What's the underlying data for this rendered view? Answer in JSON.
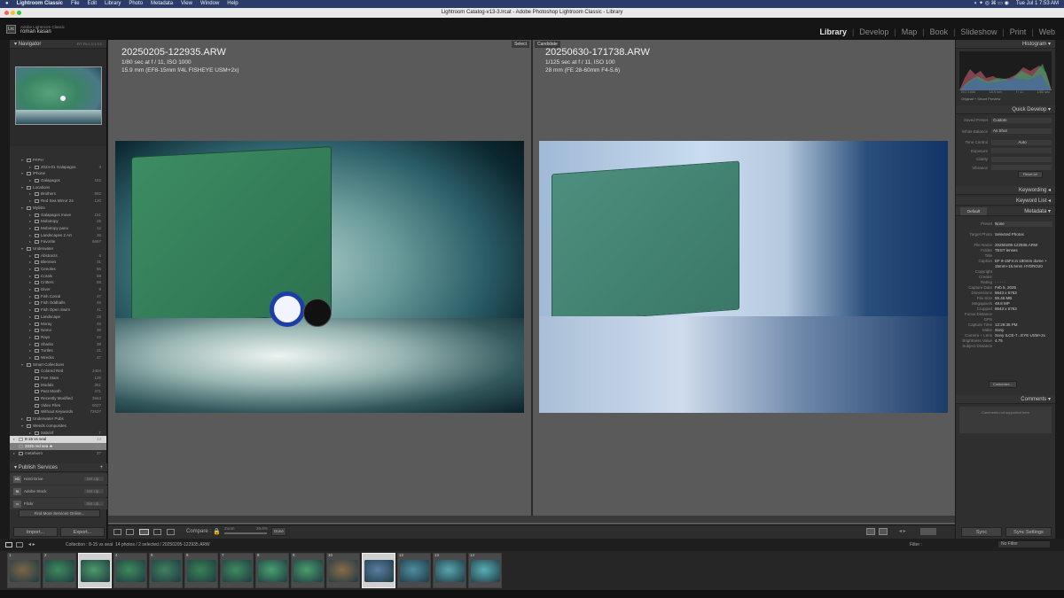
{
  "mac_menu": {
    "apple": "",
    "app": "Lightroom Classic",
    "items": [
      "File",
      "Edit",
      "Library",
      "Photo",
      "Metadata",
      "View",
      "Window",
      "Help"
    ],
    "clock": "Tue Jul 1 7:53 AM"
  },
  "window_title": "Lightroom Catalog-v13-3.lrcat - Adobe Photoshop Lightroom Classic - Library",
  "identity": {
    "sub": "Adobe Lightroom Classic",
    "name": "roman kasan",
    "logo": "Lrc"
  },
  "modules": [
    "Library",
    "Develop",
    "Map",
    "Book",
    "Slideshow",
    "Print",
    "Web"
  ],
  "navigator": {
    "title": "Navigator",
    "opts": "FIT   FILL   1:1   3:1"
  },
  "folders": [
    {
      "label": "FFPH",
      "count": "",
      "lvl": 1,
      "tri": "▾",
      "type": "set"
    },
    {
      "label": "2024-01 Galapagos",
      "count": "3",
      "lvl": 2,
      "tri": "▸",
      "type": "col"
    },
    {
      "label": "iPhone",
      "count": "",
      "lvl": 1,
      "tri": "▾",
      "type": "set"
    },
    {
      "label": "Galapagos",
      "count": "182",
      "lvl": 2,
      "tri": "▸",
      "type": "col"
    },
    {
      "label": "Locations",
      "count": "",
      "lvl": 1,
      "tri": "▾",
      "type": "set"
    },
    {
      "label": "Brothers",
      "count": "992",
      "lvl": 2,
      "tri": "▸",
      "type": "col"
    },
    {
      "label": "Red Sea Mirror 24",
      "count": "130",
      "lvl": 2,
      "tri": "▸",
      "type": "col"
    },
    {
      "label": "Mylists",
      "count": "",
      "lvl": 1,
      "tri": "▾",
      "type": "set"
    },
    {
      "label": "Galapagos move",
      "count": "151",
      "lvl": 2,
      "tri": "▸",
      "type": "col"
    },
    {
      "label": "Mobotopy",
      "count": "25",
      "lvl": 2,
      "tri": "▸",
      "type": "col"
    },
    {
      "label": "Mobotopy pano",
      "count": "12",
      "lvl": 2,
      "tri": "▸",
      "type": "col"
    },
    {
      "label": "Landscapes 2 Art",
      "count": "36",
      "lvl": 2,
      "tri": "▸",
      "type": "col"
    },
    {
      "label": "Favorite",
      "count": "6657",
      "lvl": 2,
      "tri": "▸",
      "type": "col"
    },
    {
      "label": "Underwater",
      "count": "",
      "lvl": 1,
      "tri": "▾",
      "type": "set"
    },
    {
      "label": "Abstracts",
      "count": "6",
      "lvl": 2,
      "tri": "▸",
      "type": "col"
    },
    {
      "label": "Blennies",
      "count": "31",
      "lvl": 2,
      "tri": "▸",
      "type": "col"
    },
    {
      "label": "Cenotes",
      "count": "66",
      "lvl": 2,
      "tri": "▸",
      "type": "col"
    },
    {
      "label": "Corals",
      "count": "59",
      "lvl": 2,
      "tri": "▸",
      "type": "col"
    },
    {
      "label": "Critters",
      "count": "88",
      "lvl": 2,
      "tri": "▸",
      "type": "col"
    },
    {
      "label": "Diver",
      "count": "9",
      "lvl": 2,
      "tri": "▸",
      "type": "col"
    },
    {
      "label": "Fish Corral",
      "count": "47",
      "lvl": 2,
      "tri": "▸",
      "type": "col"
    },
    {
      "label": "Fish Oddballs",
      "count": "46",
      "lvl": 2,
      "tri": "▸",
      "type": "col"
    },
    {
      "label": "Fish Open Swim",
      "count": "41",
      "lvl": 2,
      "tri": "▸",
      "type": "col"
    },
    {
      "label": "Landscape",
      "count": "29",
      "lvl": 2,
      "tri": "▸",
      "type": "col"
    },
    {
      "label": "Moray",
      "count": "46",
      "lvl": 2,
      "tri": "▸",
      "type": "col"
    },
    {
      "label": "Nemo",
      "count": "36",
      "lvl": 2,
      "tri": "▸",
      "type": "col"
    },
    {
      "label": "Rays",
      "count": "22",
      "lvl": 2,
      "tri": "▸",
      "type": "col"
    },
    {
      "label": "Sharks",
      "count": "38",
      "lvl": 2,
      "tri": "▸",
      "type": "col"
    },
    {
      "label": "Turtles",
      "count": "31",
      "lvl": 2,
      "tri": "▸",
      "type": "col"
    },
    {
      "label": "Wrecks",
      "count": "47",
      "lvl": 2,
      "tri": "▸",
      "type": "col"
    },
    {
      "label": "Smart Collections",
      "count": "",
      "lvl": 1,
      "tri": "▾",
      "type": "set"
    },
    {
      "label": "Colored Red",
      "count": "2404",
      "lvl": 2,
      "tri": "",
      "type": "smart"
    },
    {
      "label": "Five Stars",
      "count": "125",
      "lvl": 2,
      "tri": "",
      "type": "smart"
    },
    {
      "label": "Modals",
      "count": "351",
      "lvl": 2,
      "tri": "",
      "type": "smart"
    },
    {
      "label": "Past Month",
      "count": "471",
      "lvl": 2,
      "tri": "",
      "type": "smart"
    },
    {
      "label": "Recently Modified",
      "count": "3663",
      "lvl": 2,
      "tri": "",
      "type": "smart"
    },
    {
      "label": "Video Files",
      "count": "6027",
      "lvl": 2,
      "tri": "",
      "type": "smart"
    },
    {
      "label": "Without Keywords",
      "count": "72637",
      "lvl": 2,
      "tri": "",
      "type": "smart"
    },
    {
      "label": "Underwater Pubs",
      "count": "",
      "lvl": 1,
      "tri": "▸",
      "type": "set"
    },
    {
      "label": "Weeds composites",
      "count": "",
      "lvl": 1,
      "tri": "▾",
      "type": "set"
    },
    {
      "label": "Sabrinf",
      "count": "7",
      "lvl": 2,
      "tri": "▸",
      "type": "col"
    },
    {
      "label": "8-15 vs seal",
      "count": "14",
      "lvl": 0,
      "tri": "▸",
      "type": "col",
      "sel": 2
    },
    {
      "label": "2025 red sea ★",
      "count": "956",
      "lvl": 0,
      "tri": "▸",
      "type": "col",
      "sel": 1
    },
    {
      "label": "metahiero",
      "count": "37",
      "lvl": 0,
      "tri": "▸",
      "type": "col"
    }
  ],
  "publish": {
    "title": "Publish Services",
    "items": [
      {
        "icon": "HD",
        "label": "Hard Drive",
        "action": "Set Up..."
      },
      {
        "icon": "St",
        "label": "Adobe Stock",
        "action": "Set Up..."
      },
      {
        "icon": "••",
        "label": "Flickr",
        "action": "Set Up..."
      }
    ],
    "find_more": "Find More Services Online..."
  },
  "import_btn": "Import...",
  "export_btn": "Export...",
  "select": {
    "badge": "Select",
    "filename": "20250205-122935.ARW",
    "exposure": "1/80 sec at f / 11, ISO 1000",
    "lens": "15.9 mm (EF8-15mm f/4L FISHEYE USM+2x)"
  },
  "candidate": {
    "badge": "Candidate",
    "filename": "20250630-171738.ARW",
    "exposure": "1/125 sec at f / 11, ISO 100",
    "lens": "28 mm (FE 28-60mm F4-5.6)"
  },
  "toolbar": {
    "compare": "Compare :",
    "zoom": "Zoom",
    "zoom_val": "29.8%",
    "done": "Done"
  },
  "filmstrip": {
    "path": "Collection : 8-15 vs seal",
    "info": "14 photos / 2 selected / 20250205-122935.ARW",
    "filter": "Filter :",
    "filter_val": "No Filter"
  },
  "thumbs": [
    {
      "n": "1",
      "c": "#7d6547"
    },
    {
      "n": "2",
      "c": "#3f8a5c"
    },
    {
      "n": "3",
      "c": "#4e9a6a",
      "sel": true
    },
    {
      "n": "4",
      "c": "#3f8a5c"
    },
    {
      "n": "5",
      "c": "#41805e"
    },
    {
      "n": "6",
      "c": "#3a8254"
    },
    {
      "n": "7",
      "c": "#418a5e"
    },
    {
      "n": "8",
      "c": "#49a070"
    },
    {
      "n": "9",
      "c": "#4a9e6c"
    },
    {
      "n": "10",
      "c": "#8a6a4a"
    },
    {
      "n": "11",
      "c": "#5a7ea3",
      "sel": true
    },
    {
      "n": "12",
      "c": "#4f8ca0"
    },
    {
      "n": "13",
      "c": "#58a5b0"
    },
    {
      "n": "14",
      "c": "#5aaeb5"
    }
  ],
  "histogram": {
    "title": "Histogram",
    "labels": [
      "ISO 1000",
      "15.9 mm",
      "f / 11",
      "1/80 sec"
    ],
    "preview": "Original + Smart Preview"
  },
  "quick_develop": {
    "title": "Quick Develop",
    "saved_preset": "Saved Preset",
    "preset_val": "Custom",
    "white_balance": "White Balance",
    "wb_val": "As Shot",
    "tone_control": "Tone Control",
    "auto": "Auto",
    "exposure": "Exposure",
    "clarity": "Clarity",
    "vibrance": "Vibrance",
    "reset": "Reset All"
  },
  "keywording": "Keywording",
  "keyword_list": "Keyword List",
  "metadata": {
    "title": "Metadata",
    "preset": "Default",
    "preset_label": "Preset",
    "preset_val": "None",
    "target_label": "Target Photo",
    "target_val": "Selected Photos",
    "rows": [
      [
        "File Name",
        "20250205-122935.ARW"
      ],
      [
        "Folder",
        "TEST lenses"
      ],
      [
        "Title",
        ""
      ],
      [
        "Caption",
        "EF 8-15F4 in 180mm dome + 15mm+15.5mm HYDRO20"
      ],
      [
        "",
        ""
      ],
      [
        "Copyright",
        ""
      ],
      [
        "Creator",
        ""
      ],
      [
        "Rating",
        "· · · · ·"
      ],
      [
        "Capture Date",
        "Feb 5, 2025"
      ],
      [
        "Dimensions",
        "8643 x 5763"
      ],
      [
        "File Size",
        "55.46 MB"
      ],
      [
        "Megapixels",
        "49.8 MP"
      ],
      [
        "Cropped",
        "8643 x 5763"
      ],
      [
        "Focus Distance",
        ""
      ],
      [
        "GPS",
        ""
      ],
      [
        "Capture Time",
        "12:29:35 PM"
      ],
      [
        "Make",
        "Sony"
      ],
      [
        "Camera + Lens",
        "Sony ILCE-7...EYE USM+2x"
      ],
      [
        "Brightness Value",
        "4.75"
      ],
      [
        "Subject Distance",
        ""
      ]
    ],
    "customize": "Customize..."
  },
  "comments": {
    "title": "Comments",
    "text": "Comments not supported here"
  },
  "sync": "Sync",
  "sync_settings": "Sync Settings"
}
